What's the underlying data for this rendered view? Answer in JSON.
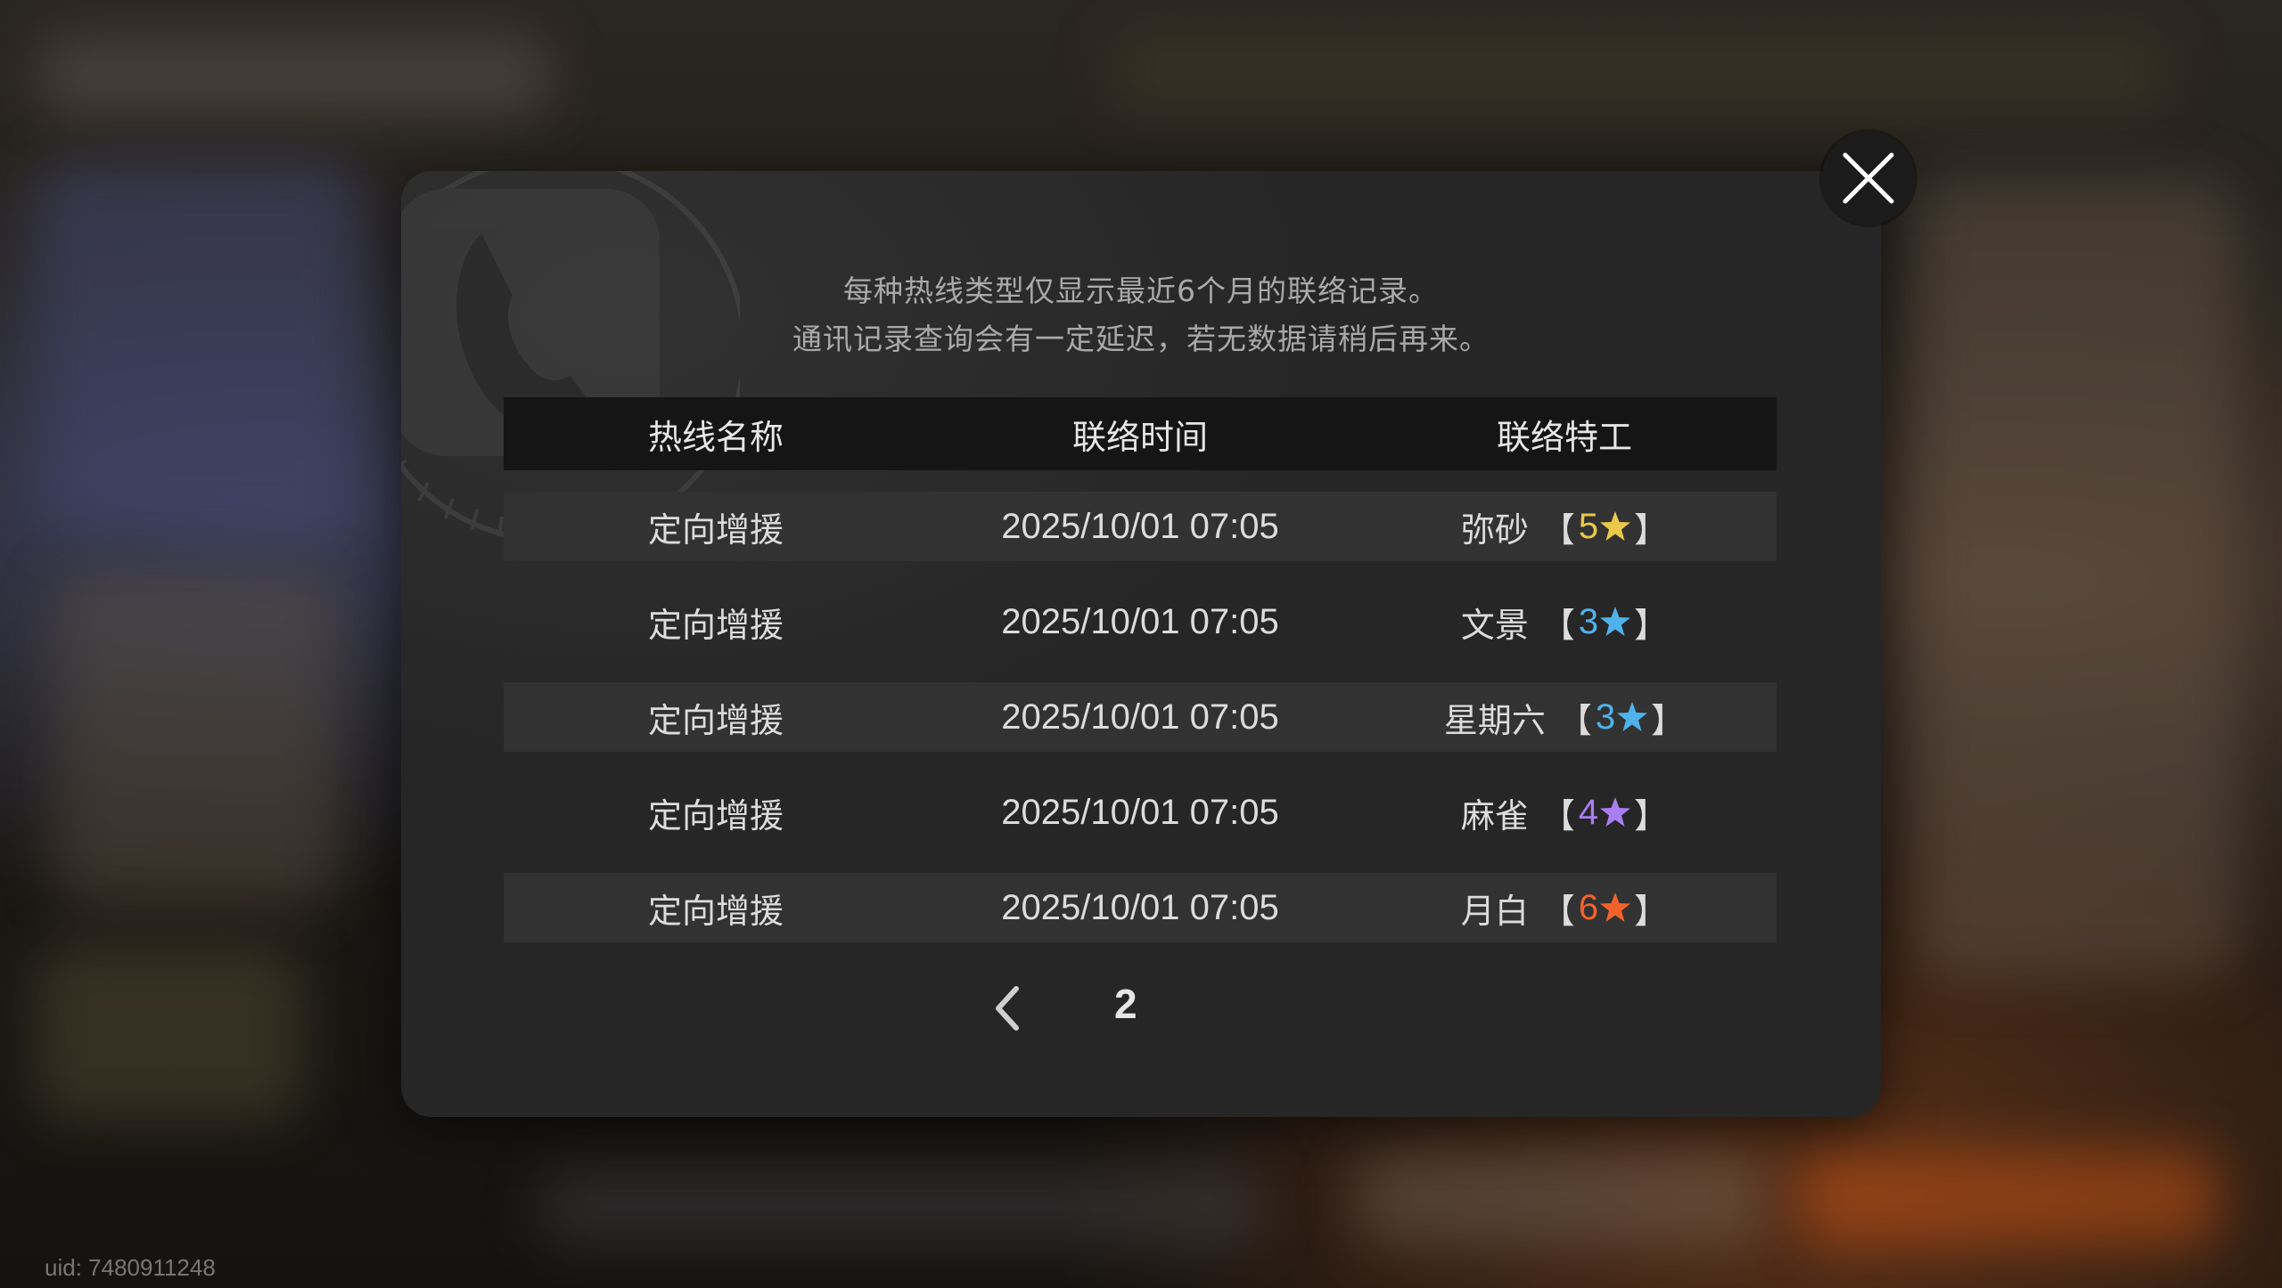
{
  "uid_label": "uid: 7480911248",
  "notice": {
    "line1": "每种热线类型仅显示最近6个月的联络记录。",
    "line2": "通讯记录查询会有一定延迟，若无数据请稍后再来。"
  },
  "table": {
    "headers": [
      "热线名称",
      "联络时间",
      "联络特工"
    ],
    "rows": [
      {
        "hotline": "定向增援",
        "time": "2025/10/01 07:05",
        "agent": "弥砂",
        "rarity": "5",
        "star_color": "#e8c94a"
      },
      {
        "hotline": "定向增援",
        "time": "2025/10/01 07:05",
        "agent": "文景",
        "rarity": "3",
        "star_color": "#4fb2ea"
      },
      {
        "hotline": "定向增援",
        "time": "2025/10/01 07:05",
        "agent": "星期六",
        "rarity": "3",
        "star_color": "#4fb2ea"
      },
      {
        "hotline": "定向增援",
        "time": "2025/10/01 07:05",
        "agent": "麻雀",
        "rarity": "4",
        "star_color": "#a97ef0"
      },
      {
        "hotline": "定向增援",
        "time": "2025/10/01 07:05",
        "agent": "月白",
        "rarity": "6",
        "star_color": "#f2622a"
      }
    ]
  },
  "pager": {
    "page": "2"
  },
  "bracket_open": "【",
  "bracket_close": "】",
  "icons": {
    "close": "close-icon",
    "prev": "chevron-left-icon",
    "star": "star-icon",
    "phone": "phone-icon"
  }
}
